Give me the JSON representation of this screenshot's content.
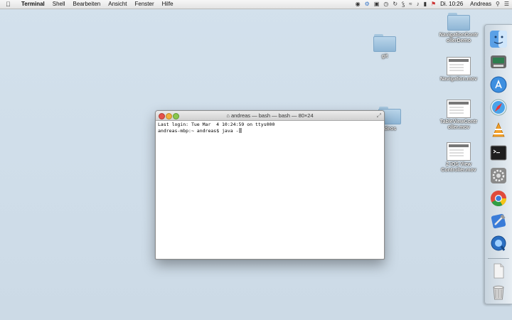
{
  "menubar": {
    "app": "Terminal",
    "items": [
      "Shell",
      "Bearbeiten",
      "Ansicht",
      "Fenster",
      "Hilfe"
    ],
    "clock": "Di. 10:26",
    "user": "Andreas"
  },
  "desktop": {
    "icons": [
      {
        "label": "git",
        "kind": "folder"
      },
      {
        "label": "NavigationContr ollerDemo",
        "kind": "folder"
      },
      {
        "label": "Navigation.mov",
        "kind": "movie"
      },
      {
        "label": "TableViewContr oller.mov",
        "kind": "movie"
      },
      {
        "label": "2 iOS View Controller.mov",
        "kind": "movie"
      },
      {
        "label": "ideos",
        "kind": "folder"
      }
    ]
  },
  "terminal": {
    "title": "andreas — bash — bash — 80×24",
    "lines": [
      "Last login: Tue Mar  4 10:24:59 on ttys000",
      "andreas-mbp:~ andreas$ java -"
    ]
  },
  "dock": {
    "items": [
      {
        "name": "finder-icon",
        "color": "#5aa0e6"
      },
      {
        "name": "automator-icon",
        "color": "#6a6a6a"
      },
      {
        "name": "app-store-icon",
        "color": "#3d8fe0"
      },
      {
        "name": "safari-icon",
        "color": "#4aa3e8"
      },
      {
        "name": "vlc-icon",
        "color": "#f2a12b"
      },
      {
        "name": "terminal-icon",
        "color": "#1e1e1e"
      },
      {
        "name": "system-preferences-icon",
        "color": "#8a8a8a"
      },
      {
        "name": "chrome-icon",
        "color": "#e04b3c"
      },
      {
        "name": "xcode-icon",
        "color": "#3a7cd8"
      },
      {
        "name": "quicktime-icon",
        "color": "#2b6fc2"
      },
      {
        "name": "document-icon",
        "color": "#dddddd"
      },
      {
        "name": "trash-icon",
        "color": "#b5b5b5"
      }
    ]
  }
}
